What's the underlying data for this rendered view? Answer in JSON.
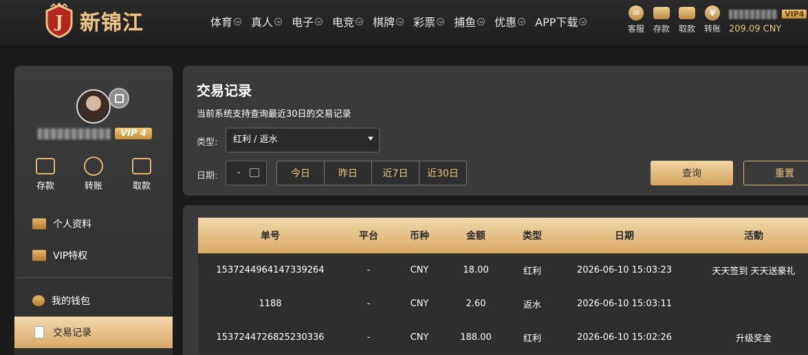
{
  "brand": {
    "name": "新锦江",
    "badge_letter": "J"
  },
  "nav": [
    "体育",
    "真人",
    "电子",
    "电竞",
    "棋牌",
    "彩票",
    "捕鱼",
    "优惠",
    "APP下载"
  ],
  "quick_actions": [
    "客服",
    "存款",
    "取款",
    "转账"
  ],
  "header_user": {
    "vip": "VIP4",
    "balance": "209.09 CNY"
  },
  "sidebar": {
    "vip": "VIP 4",
    "actions": [
      "存款",
      "转账",
      "取款"
    ],
    "menu": [
      "个人资料",
      "VIP特权",
      "我的钱包",
      "交易记录"
    ]
  },
  "filter": {
    "title": "交易记录",
    "subtitle": "当前系统支持查询最近30日的交易记录",
    "type_label": "类型:",
    "type_value": "红利 / 返水",
    "date_label": "日期:",
    "date_value": "-",
    "ranges": [
      "今日",
      "昨日",
      "近7日",
      "近30日"
    ],
    "query_label": "查询",
    "reset_label": "重置"
  },
  "table": {
    "headers": [
      "单号",
      "平台",
      "币种",
      "金额",
      "类型",
      "日期",
      "活動"
    ],
    "rows": [
      [
        "1537244964147339264",
        "-",
        "CNY",
        "18.00",
        "红利",
        "2026-06-10 15:03:23",
        "天天签到 天天送豪礼"
      ],
      [
        "1188",
        "-",
        "CNY",
        "2.60",
        "返水",
        "2026-06-10 15:03:11",
        ""
      ],
      [
        "1537244726825230336",
        "-",
        "CNY",
        "188.00",
        "红利",
        "2026-06-10 15:02:26",
        "升级奖金"
      ]
    ]
  },
  "colors": {
    "accent": "#e0b673",
    "gold_text": "#e9c67f",
    "panel": "#3a3a3a",
    "background": "#1b1b1b"
  }
}
